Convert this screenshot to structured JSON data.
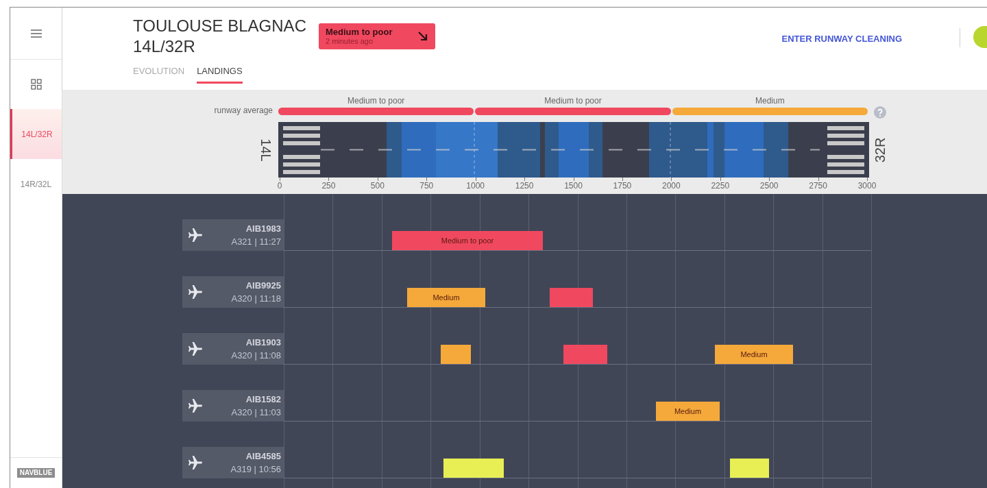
{
  "sidebar": {
    "items": [
      {
        "label": "14L/32R",
        "selected": true
      },
      {
        "label": "14R/32L",
        "selected": false
      }
    ],
    "logo": "NAVBLUE"
  },
  "header": {
    "airport": "TOULOUSE BLAGNAC",
    "runway": "14L/32R",
    "status": {
      "label": "Medium to poor",
      "time": "2 minutes ago",
      "color": "#f0485f"
    },
    "action": "ENTER RUNWAY CLEANING"
  },
  "tabs": [
    {
      "label": "EVOLUTION",
      "selected": false
    },
    {
      "label": "LANDINGS",
      "selected": true
    }
  ],
  "runway": {
    "average_label": "runway average",
    "segments": [
      {
        "label": "Medium to poor",
        "color": "#f0485f"
      },
      {
        "label": "Medium to poor",
        "color": "#f0485f"
      },
      {
        "label": "Medium",
        "color": "#f5a93a"
      }
    ],
    "ends": [
      "14L",
      "32R"
    ],
    "axis_ticks": [
      "0",
      "250",
      "500",
      "750",
      "1000",
      "1250",
      "1500",
      "1750",
      "2000",
      "2250",
      "2500",
      "2750",
      "3000"
    ]
  },
  "landings": [
    {
      "flight": "AIB1983",
      "info": "A321 | 11:27",
      "bars": [
        {
          "color": "#f0485f",
          "label": "Medium to poor"
        }
      ]
    },
    {
      "flight": "AIB9925",
      "info": "A320 | 11:18",
      "bars": [
        {
          "color": "#f5a93a",
          "label": "Medium"
        },
        {
          "color": "#f0485f"
        }
      ]
    },
    {
      "flight": "AIB1903",
      "info": "A320 | 11:08",
      "bars": [
        {
          "color": "#f5a93a"
        },
        {
          "color": "#f0485f"
        },
        {
          "color": "#f5a93a",
          "label": "Medium"
        }
      ]
    },
    {
      "flight": "AIB1582",
      "info": "A320 | 11:03",
      "bars": [
        {
          "color": "#f5a93a",
          "label": "Medium"
        }
      ]
    },
    {
      "flight": "AIB4585",
      "info": "A319 | 10:56",
      "bars": [
        {
          "color": "#e8ef55"
        },
        {
          "color": "#e8ef55"
        }
      ]
    }
  ]
}
